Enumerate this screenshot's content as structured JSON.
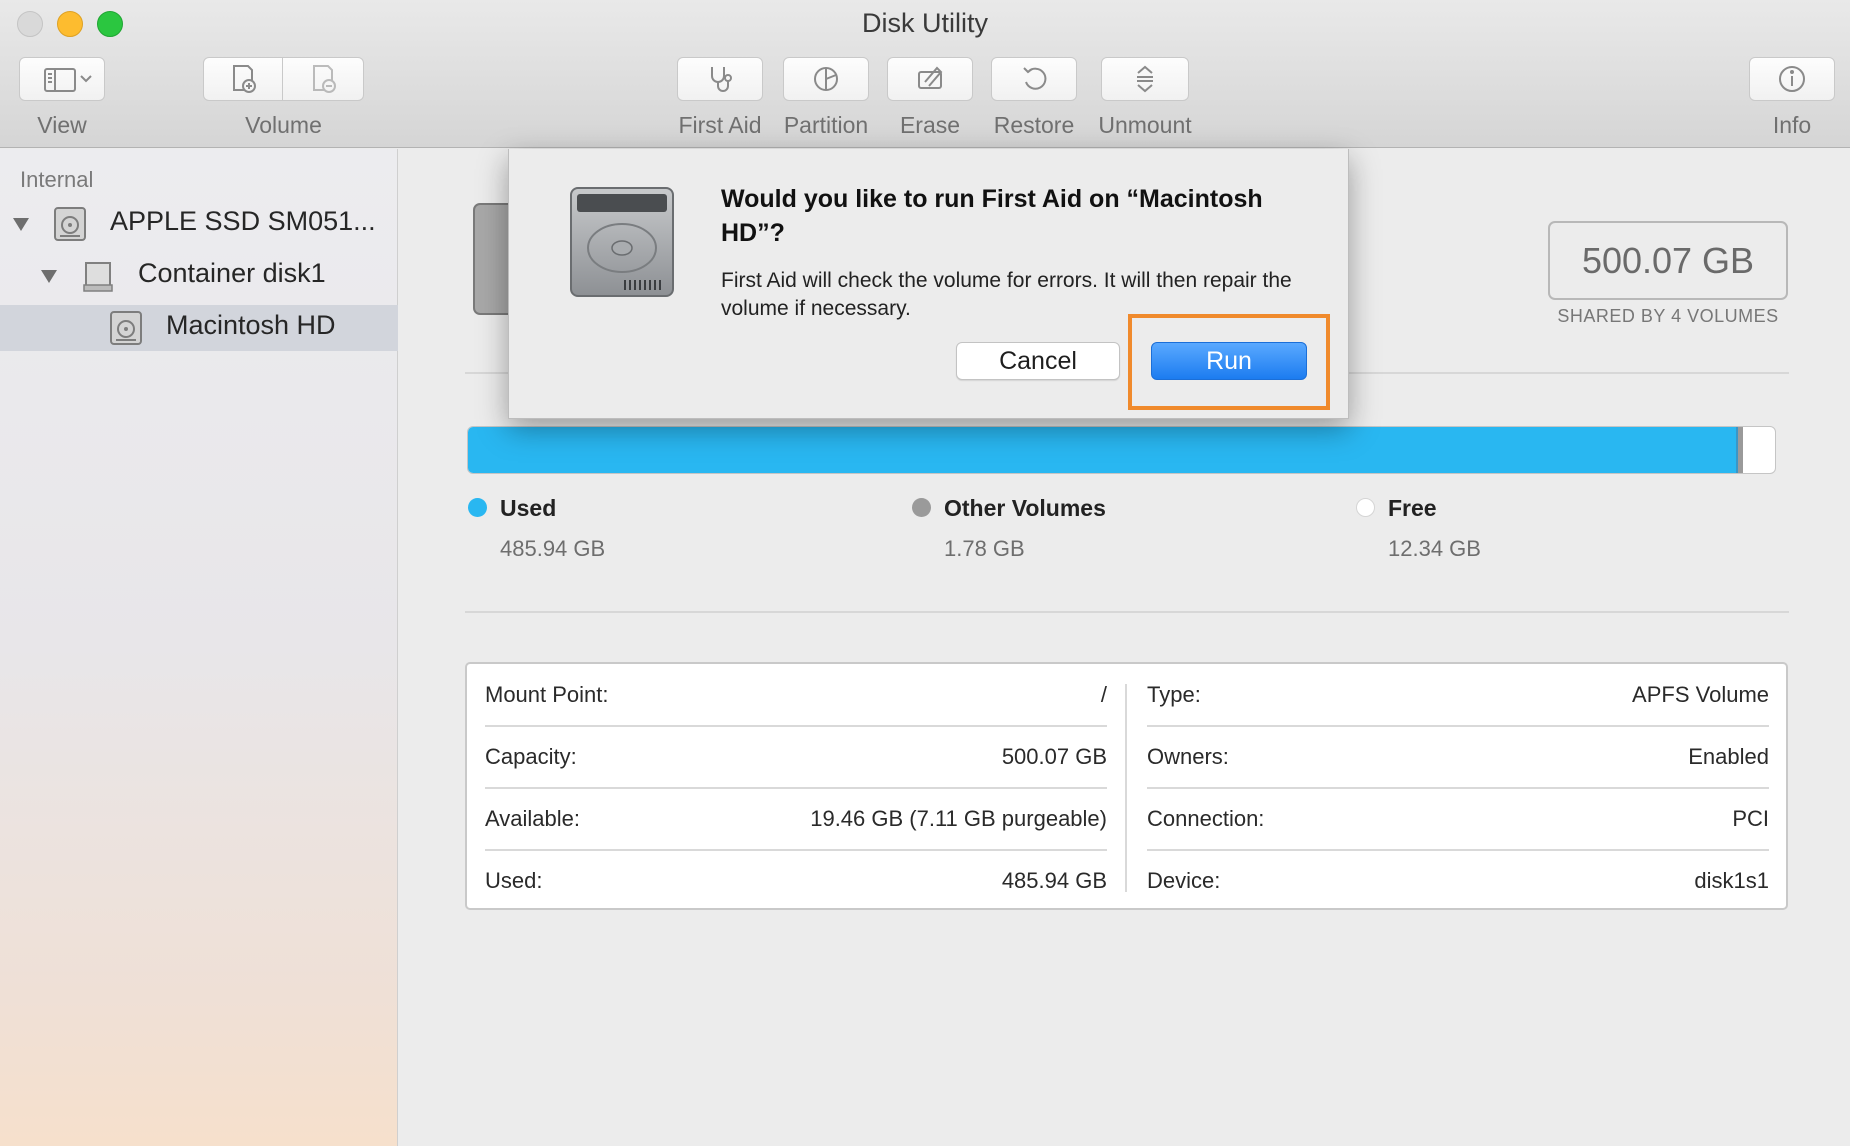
{
  "window": {
    "title": "Disk Utility"
  },
  "toolbar": {
    "view_label": "View",
    "volume_label": "Volume",
    "first_aid_label": "First Aid",
    "partition_label": "Partition",
    "erase_label": "Erase",
    "restore_label": "Restore",
    "unmount_label": "Unmount",
    "info_label": "Info"
  },
  "sidebar": {
    "header": "Internal",
    "items": [
      {
        "label": "APPLE SSD SM051...",
        "icon": "internal-disk-icon"
      },
      {
        "label": "Container disk1",
        "icon": "container-icon"
      },
      {
        "label": "Macintosh HD",
        "icon": "volume-icon",
        "selected": true
      }
    ]
  },
  "main": {
    "capacity": "500.07 GB",
    "capacity_sub": "SHARED BY 4 VOLUMES",
    "usage": {
      "used_fraction": 0.9717,
      "other_fraction": 0.0036,
      "free_fraction": 0.0247,
      "colors": {
        "used": "#29b7f1",
        "other": "#9a9a9a",
        "free": "#ffffff"
      }
    },
    "legend": [
      {
        "name": "Used",
        "value": "485.94 GB"
      },
      {
        "name": "Other Volumes",
        "value": "1.78 GB"
      },
      {
        "name": "Free",
        "value": "12.34 GB"
      }
    ],
    "info_left": [
      {
        "key": "Mount Point:",
        "value": "/"
      },
      {
        "key": "Capacity:",
        "value": "500.07 GB"
      },
      {
        "key": "Available:",
        "value": "19.46 GB (7.11 GB purgeable)"
      },
      {
        "key": "Used:",
        "value": "485.94 GB"
      }
    ],
    "info_right": [
      {
        "key": "Type:",
        "value": "APFS Volume"
      },
      {
        "key": "Owners:",
        "value": "Enabled"
      },
      {
        "key": "Connection:",
        "value": "PCI"
      },
      {
        "key": "Device:",
        "value": "disk1s1"
      }
    ]
  },
  "dialog": {
    "title": "Would you like to run First Aid on “Macintosh HD”?",
    "message": "First Aid will check the volume for errors. It will then repair the volume if necessary.",
    "cancel_label": "Cancel",
    "run_label": "Run",
    "highlight_color": "#f08a2c"
  }
}
